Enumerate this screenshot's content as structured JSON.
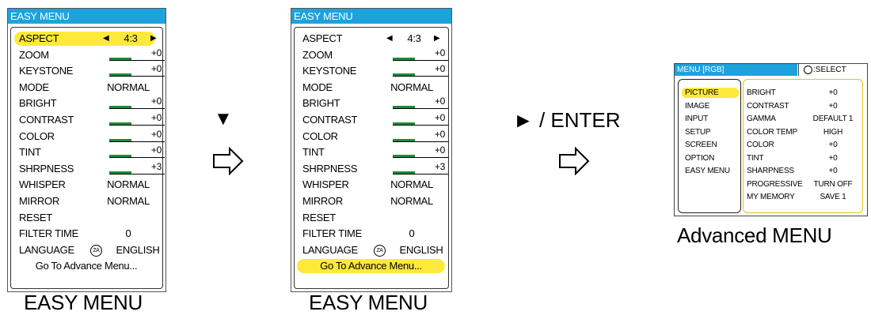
{
  "panels": [
    {
      "title": "EASY MENU",
      "caption": "EASY MENU",
      "rows": [
        {
          "label": "ASPECT",
          "value": "4:3",
          "kind": "arrows",
          "highlight": true
        },
        {
          "label": "ZOOM",
          "value": "+0",
          "kind": "bar"
        },
        {
          "label": "KEYSTONE",
          "value": "+0",
          "kind": "bar"
        },
        {
          "label": "MODE",
          "value": "NORMAL",
          "kind": "text"
        },
        {
          "label": "BRIGHT",
          "value": "+0",
          "kind": "bar"
        },
        {
          "label": "CONTRAST",
          "value": "+0",
          "kind": "bar"
        },
        {
          "label": "COLOR",
          "value": "+0",
          "kind": "bar"
        },
        {
          "label": "TINT",
          "value": "+0",
          "kind": "bar"
        },
        {
          "label": "SHRPNESS",
          "value": "+3",
          "kind": "bar"
        },
        {
          "label": "WHISPER",
          "value": "NORMAL",
          "kind": "text"
        },
        {
          "label": "MIRROR",
          "value": "NORMAL",
          "kind": "text"
        },
        {
          "label": "RESET",
          "value": "",
          "kind": "none"
        },
        {
          "label": "FILTER TIME",
          "value": "0",
          "kind": "text"
        },
        {
          "label": "LANGUAGE",
          "value": "ENGLISH",
          "kind": "lang"
        },
        {
          "label": "Go To Advance Menu...",
          "value": "",
          "kind": "center"
        }
      ]
    },
    {
      "title": "EASY MENU",
      "caption": "EASY MENU",
      "rows": [
        {
          "label": "ASPECT",
          "value": "4:3",
          "kind": "arrows"
        },
        {
          "label": "ZOOM",
          "value": "+0",
          "kind": "bar"
        },
        {
          "label": "KEYSTONE",
          "value": "+0",
          "kind": "bar"
        },
        {
          "label": "MODE",
          "value": "NORMAL",
          "kind": "text"
        },
        {
          "label": "BRIGHT",
          "value": "+0",
          "kind": "bar"
        },
        {
          "label": "CONTRAST",
          "value": "+0",
          "kind": "bar"
        },
        {
          "label": "COLOR",
          "value": "+0",
          "kind": "bar"
        },
        {
          "label": "TINT",
          "value": "+0",
          "kind": "bar"
        },
        {
          "label": "SHRPNESS",
          "value": "+3",
          "kind": "bar"
        },
        {
          "label": "WHISPER",
          "value": "NORMAL",
          "kind": "text"
        },
        {
          "label": "MIRROR",
          "value": "NORMAL",
          "kind": "text"
        },
        {
          "label": "RESET",
          "value": "",
          "kind": "none"
        },
        {
          "label": "FILTER TIME",
          "value": "0",
          "kind": "text"
        },
        {
          "label": "LANGUAGE",
          "value": "ENGLISH",
          "kind": "lang"
        },
        {
          "label": "Go To Advance Menu...",
          "value": "",
          "kind": "center",
          "highlight": true
        }
      ]
    }
  ],
  "arrow_left_glyph": "◀",
  "arrow_right_glyph": "▶",
  "language_icon_text": "ZA",
  "flow1": {
    "symbol": "▼"
  },
  "flow2": {
    "label": "► / ENTER"
  },
  "advanced": {
    "title": "MENU [RGB]",
    "select_label": ":SELECT",
    "caption": "Advanced MENU",
    "left_items": [
      {
        "label": "PICTURE",
        "highlight": true
      },
      {
        "label": "IMAGE"
      },
      {
        "label": "INPUT"
      },
      {
        "label": "SETUP"
      },
      {
        "label": "SCREEN"
      },
      {
        "label": "OPTION"
      },
      {
        "label": "EASY MENU"
      }
    ],
    "right_items": [
      {
        "label": "BRIGHT",
        "value": "+0"
      },
      {
        "label": "CONTRAST",
        "value": "+0"
      },
      {
        "label": "GAMMA",
        "value": "DEFAULT 1"
      },
      {
        "label": "COLOR TEMP",
        "value": "HIGH"
      },
      {
        "label": "COLOR",
        "value": "+0"
      },
      {
        "label": "TINT",
        "value": "+0"
      },
      {
        "label": "SHARPNESS",
        "value": "+0"
      },
      {
        "label": "PROGRESSIVE",
        "value": "TURN OFF"
      },
      {
        "label": "MY MEMORY",
        "value": "SAVE 1"
      }
    ]
  },
  "colors": {
    "title_bar": "#1ea2dc",
    "highlight": "#fde93a",
    "bar_fill": "#1d8a3a",
    "adv_border": "#e4c21a"
  }
}
